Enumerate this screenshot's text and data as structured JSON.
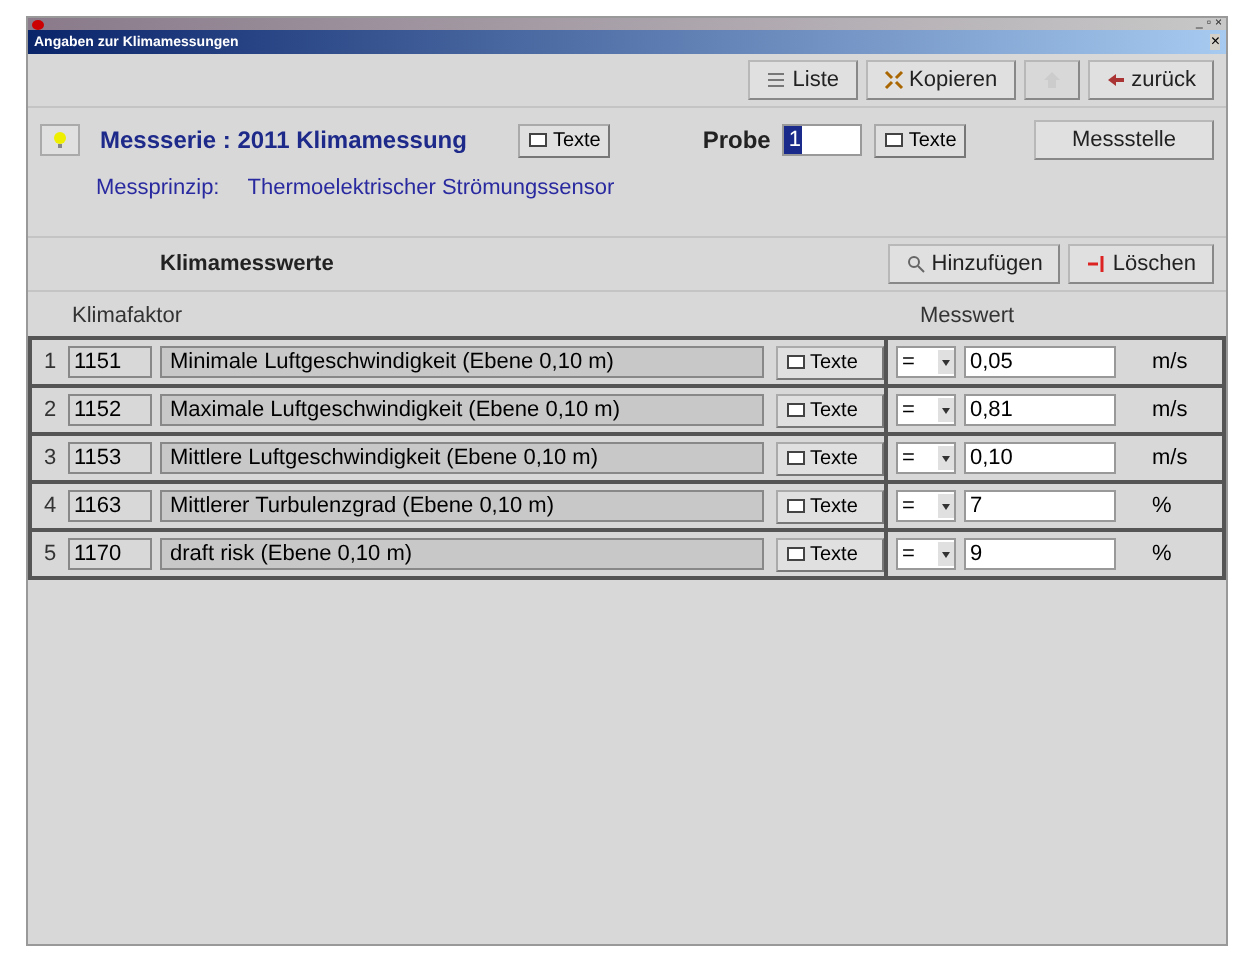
{
  "window": {
    "subtitle": "Angaben zur Klimamessungen",
    "controls": [
      "_",
      "▫",
      "×"
    ],
    "close": "×"
  },
  "toolbar": [
    {
      "label": "Liste",
      "kind": "list",
      "disabled": false
    },
    {
      "label": "Kopieren",
      "kind": "copy",
      "disabled": false
    },
    {
      "kind": "up",
      "disabled": true
    },
    {
      "label": "zurück",
      "kind": "back",
      "disabled": false
    }
  ],
  "header": {
    "series": "Messserie : 2011 Klimamessung",
    "texte_button": "Texte",
    "probe_label": "Probe",
    "probe_value": "1",
    "probe_texte_button": "Texte",
    "messstelle_button": "Messstelle",
    "principle_label": "Messprinzip:",
    "principle_value": "Thermoelektrischer Strömungssensor"
  },
  "section": {
    "title": "Klimamesswerte",
    "add_button": "Hinzufügen",
    "delete_button": "Löschen"
  },
  "table": {
    "columns": [
      "Klimafaktor",
      "Messwert"
    ],
    "rows": [
      {
        "index": "1",
        "code": "1151",
        "name": "Minimale Luftgeschwindigkeit (Ebene 0,10 m)",
        "texte": "Texte",
        "operator": "=",
        "value": "0,05",
        "unit": "m/s"
      },
      {
        "index": "2",
        "code": "1152",
        "name": "Maximale Luftgeschwindigkeit (Ebene 0,10 m)",
        "texte": "Texte",
        "operator": "=",
        "value": "0,81",
        "unit": "m/s"
      },
      {
        "index": "3",
        "code": "1153",
        "name": "Mittlere Luftgeschwindigkeit (Ebene 0,10 m)",
        "texte": "Texte",
        "operator": "=",
        "value": "0,10",
        "unit": "m/s"
      },
      {
        "index": "4",
        "code": "1163",
        "name": "Mittlerer Turbulenzgrad (Ebene 0,10 m)",
        "texte": "Texte",
        "operator": "=",
        "value": "7",
        "unit": "%"
      },
      {
        "index": "5",
        "code": "1170",
        "name": "draft risk (Ebene 0,10 m)",
        "texte": "Texte",
        "operator": "=",
        "value": "9",
        "unit": "%"
      }
    ]
  }
}
